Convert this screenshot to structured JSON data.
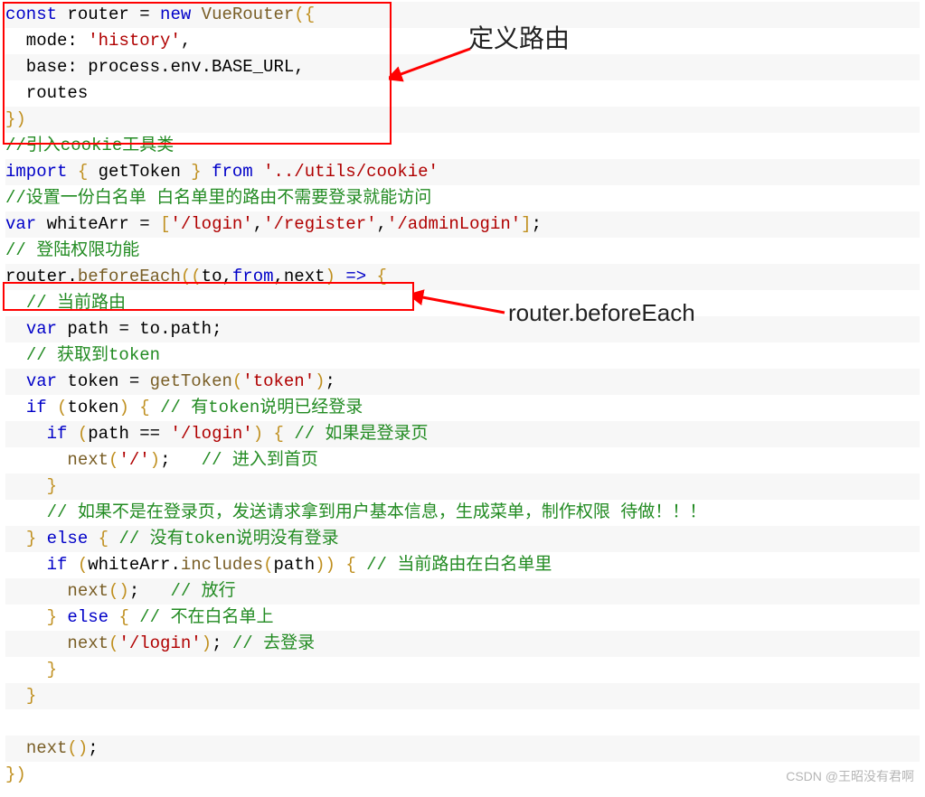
{
  "annotations": {
    "label1": "定义路由",
    "label2": "router.beforeEach"
  },
  "watermark": "CSDN @王昭没有君啊",
  "code_lines": [
    {
      "bg": "bg-odd",
      "tokens": [
        {
          "c": "kw",
          "t": "const"
        },
        {
          "c": "p",
          "t": " router "
        },
        {
          "c": "p",
          "t": "="
        },
        {
          "c": "p",
          "t": " "
        },
        {
          "c": "kw",
          "t": "new"
        },
        {
          "c": "p",
          "t": " "
        },
        {
          "c": "fn",
          "t": "VueRouter"
        },
        {
          "c": "bo",
          "t": "({"
        }
      ]
    },
    {
      "bg": "bg-even",
      "tokens": [
        {
          "c": "p",
          "t": "  mode"
        },
        {
          "c": "p",
          "t": ": "
        },
        {
          "c": "str",
          "t": "'history'"
        },
        {
          "c": "p",
          "t": ","
        }
      ]
    },
    {
      "bg": "bg-odd",
      "tokens": [
        {
          "c": "p",
          "t": "  base"
        },
        {
          "c": "p",
          "t": ": process.env.BASE_URL,"
        }
      ]
    },
    {
      "bg": "bg-even",
      "tokens": [
        {
          "c": "p",
          "t": "  routes"
        }
      ]
    },
    {
      "bg": "bg-odd",
      "tokens": [
        {
          "c": "bo",
          "t": "})"
        }
      ]
    },
    {
      "bg": "bg-even",
      "tokens": [
        {
          "c": "cm",
          "t": "//引入cookie工具类"
        }
      ]
    },
    {
      "bg": "bg-odd",
      "tokens": [
        {
          "c": "kw",
          "t": "import"
        },
        {
          "c": "p",
          "t": " "
        },
        {
          "c": "bo",
          "t": "{"
        },
        {
          "c": "p",
          "t": " getToken "
        },
        {
          "c": "bo",
          "t": "}"
        },
        {
          "c": "p",
          "t": " "
        },
        {
          "c": "kw",
          "t": "from"
        },
        {
          "c": "p",
          "t": " "
        },
        {
          "c": "str",
          "t": "'../utils/cookie'"
        }
      ]
    },
    {
      "bg": "bg-even",
      "tokens": [
        {
          "c": "cm",
          "t": "//设置一份白名单 白名单里的路由不需要登录就能访问"
        }
      ]
    },
    {
      "bg": "bg-odd",
      "tokens": [
        {
          "c": "kw",
          "t": "var"
        },
        {
          "c": "p",
          "t": " whiteArr "
        },
        {
          "c": "p",
          "t": "="
        },
        {
          "c": "p",
          "t": " "
        },
        {
          "c": "bo",
          "t": "["
        },
        {
          "c": "str",
          "t": "'/login'"
        },
        {
          "c": "p",
          "t": ","
        },
        {
          "c": "str",
          "t": "'/register'"
        },
        {
          "c": "p",
          "t": ","
        },
        {
          "c": "str",
          "t": "'/adminLogin'"
        },
        {
          "c": "bo",
          "t": "]"
        },
        {
          "c": "p",
          "t": ";"
        }
      ]
    },
    {
      "bg": "bg-even",
      "tokens": [
        {
          "c": "cm",
          "t": "// 登陆权限功能"
        }
      ]
    },
    {
      "bg": "bg-odd",
      "tokens": [
        {
          "c": "p",
          "t": "router."
        },
        {
          "c": "fn",
          "t": "beforeEach"
        },
        {
          "c": "bo",
          "t": "(("
        },
        {
          "c": "p",
          "t": "to,"
        },
        {
          "c": "kw",
          "t": "from"
        },
        {
          "c": "p",
          "t": ",next"
        },
        {
          "c": "bo",
          "t": ")"
        },
        {
          "c": "p",
          "t": " "
        },
        {
          "c": "kw",
          "t": "=>"
        },
        {
          "c": "p",
          "t": " "
        },
        {
          "c": "bo",
          "t": "{"
        }
      ]
    },
    {
      "bg": "bg-even",
      "tokens": [
        {
          "c": "p",
          "t": "  "
        },
        {
          "c": "cm",
          "t": "// 当前路由"
        }
      ]
    },
    {
      "bg": "bg-odd",
      "tokens": [
        {
          "c": "p",
          "t": "  "
        },
        {
          "c": "kw",
          "t": "var"
        },
        {
          "c": "p",
          "t": " path "
        },
        {
          "c": "p",
          "t": "="
        },
        {
          "c": "p",
          "t": " to.path;"
        }
      ]
    },
    {
      "bg": "bg-even",
      "tokens": [
        {
          "c": "p",
          "t": "  "
        },
        {
          "c": "cm",
          "t": "// 获取到token"
        }
      ]
    },
    {
      "bg": "bg-odd",
      "tokens": [
        {
          "c": "p",
          "t": "  "
        },
        {
          "c": "kw",
          "t": "var"
        },
        {
          "c": "p",
          "t": " token "
        },
        {
          "c": "p",
          "t": "="
        },
        {
          "c": "p",
          "t": " "
        },
        {
          "c": "fn",
          "t": "getToken"
        },
        {
          "c": "bo",
          "t": "("
        },
        {
          "c": "str",
          "t": "'token'"
        },
        {
          "c": "bo",
          "t": ")"
        },
        {
          "c": "p",
          "t": ";"
        }
      ]
    },
    {
      "bg": "bg-even",
      "tokens": [
        {
          "c": "p",
          "t": "  "
        },
        {
          "c": "kw",
          "t": "if"
        },
        {
          "c": "p",
          "t": " "
        },
        {
          "c": "bo",
          "t": "("
        },
        {
          "c": "p",
          "t": "token"
        },
        {
          "c": "bo",
          "t": ")"
        },
        {
          "c": "p",
          "t": " "
        },
        {
          "c": "bo",
          "t": "{"
        },
        {
          "c": "p",
          "t": " "
        },
        {
          "c": "cm",
          "t": "// 有token说明已经登录"
        }
      ]
    },
    {
      "bg": "bg-odd",
      "tokens": [
        {
          "c": "p",
          "t": "    "
        },
        {
          "c": "kw",
          "t": "if"
        },
        {
          "c": "p",
          "t": " "
        },
        {
          "c": "bo",
          "t": "("
        },
        {
          "c": "p",
          "t": "path "
        },
        {
          "c": "p",
          "t": "=="
        },
        {
          "c": "p",
          "t": " "
        },
        {
          "c": "str",
          "t": "'/login'"
        },
        {
          "c": "bo",
          "t": ")"
        },
        {
          "c": "p",
          "t": " "
        },
        {
          "c": "bo",
          "t": "{"
        },
        {
          "c": "p",
          "t": " "
        },
        {
          "c": "cm",
          "t": "// 如果是登录页"
        }
      ]
    },
    {
      "bg": "bg-even",
      "tokens": [
        {
          "c": "p",
          "t": "      "
        },
        {
          "c": "fn",
          "t": "next"
        },
        {
          "c": "bo",
          "t": "("
        },
        {
          "c": "str",
          "t": "'/'"
        },
        {
          "c": "bo",
          "t": ")"
        },
        {
          "c": "p",
          "t": ";   "
        },
        {
          "c": "cm",
          "t": "// 进入到首页"
        }
      ]
    },
    {
      "bg": "bg-odd",
      "tokens": [
        {
          "c": "p",
          "t": "    "
        },
        {
          "c": "bo",
          "t": "}"
        }
      ]
    },
    {
      "bg": "bg-even",
      "tokens": [
        {
          "c": "p",
          "t": "    "
        },
        {
          "c": "cm",
          "t": "// 如果不是在登录页，发送请求拿到用户基本信息，生成菜单，制作权限 待做！！！"
        }
      ]
    },
    {
      "bg": "bg-odd",
      "tokens": [
        {
          "c": "p",
          "t": "  "
        },
        {
          "c": "bo",
          "t": "}"
        },
        {
          "c": "p",
          "t": " "
        },
        {
          "c": "kw",
          "t": "else"
        },
        {
          "c": "p",
          "t": " "
        },
        {
          "c": "bo",
          "t": "{"
        },
        {
          "c": "p",
          "t": " "
        },
        {
          "c": "cm",
          "t": "// 没有token说明没有登录"
        }
      ]
    },
    {
      "bg": "bg-even",
      "tokens": [
        {
          "c": "p",
          "t": "    "
        },
        {
          "c": "kw",
          "t": "if"
        },
        {
          "c": "p",
          "t": " "
        },
        {
          "c": "bo",
          "t": "("
        },
        {
          "c": "p",
          "t": "whiteArr."
        },
        {
          "c": "fn",
          "t": "includes"
        },
        {
          "c": "bo",
          "t": "("
        },
        {
          "c": "p",
          "t": "path"
        },
        {
          "c": "bo",
          "t": "))"
        },
        {
          "c": "p",
          "t": " "
        },
        {
          "c": "bo",
          "t": "{"
        },
        {
          "c": "p",
          "t": " "
        },
        {
          "c": "cm",
          "t": "// 当前路由在白名单里"
        }
      ]
    },
    {
      "bg": "bg-odd",
      "tokens": [
        {
          "c": "p",
          "t": "      "
        },
        {
          "c": "fn",
          "t": "next"
        },
        {
          "c": "bo",
          "t": "()"
        },
        {
          "c": "p",
          "t": ";   "
        },
        {
          "c": "cm",
          "t": "// 放行"
        }
      ]
    },
    {
      "bg": "bg-even",
      "tokens": [
        {
          "c": "p",
          "t": "    "
        },
        {
          "c": "bo",
          "t": "}"
        },
        {
          "c": "p",
          "t": " "
        },
        {
          "c": "kw",
          "t": "else"
        },
        {
          "c": "p",
          "t": " "
        },
        {
          "c": "bo",
          "t": "{"
        },
        {
          "c": "p",
          "t": " "
        },
        {
          "c": "cm",
          "t": "// 不在白名单上"
        }
      ]
    },
    {
      "bg": "bg-odd",
      "tokens": [
        {
          "c": "p",
          "t": "      "
        },
        {
          "c": "fn",
          "t": "next"
        },
        {
          "c": "bo",
          "t": "("
        },
        {
          "c": "str",
          "t": "'/login'"
        },
        {
          "c": "bo",
          "t": ")"
        },
        {
          "c": "p",
          "t": "; "
        },
        {
          "c": "cm",
          "t": "// 去登录"
        }
      ]
    },
    {
      "bg": "bg-even",
      "tokens": [
        {
          "c": "p",
          "t": "    "
        },
        {
          "c": "bo",
          "t": "}"
        }
      ]
    },
    {
      "bg": "bg-odd",
      "tokens": [
        {
          "c": "p",
          "t": "  "
        },
        {
          "c": "bo",
          "t": "}"
        }
      ]
    },
    {
      "bg": "bg-even",
      "tokens": [
        {
          "c": "p",
          "t": ""
        }
      ]
    },
    {
      "bg": "bg-odd",
      "tokens": [
        {
          "c": "p",
          "t": "  "
        },
        {
          "c": "fn",
          "t": "next"
        },
        {
          "c": "bo",
          "t": "()"
        },
        {
          "c": "p",
          "t": ";"
        }
      ]
    },
    {
      "bg": "bg-even",
      "tokens": [
        {
          "c": "bo",
          "t": "})"
        }
      ]
    }
  ]
}
